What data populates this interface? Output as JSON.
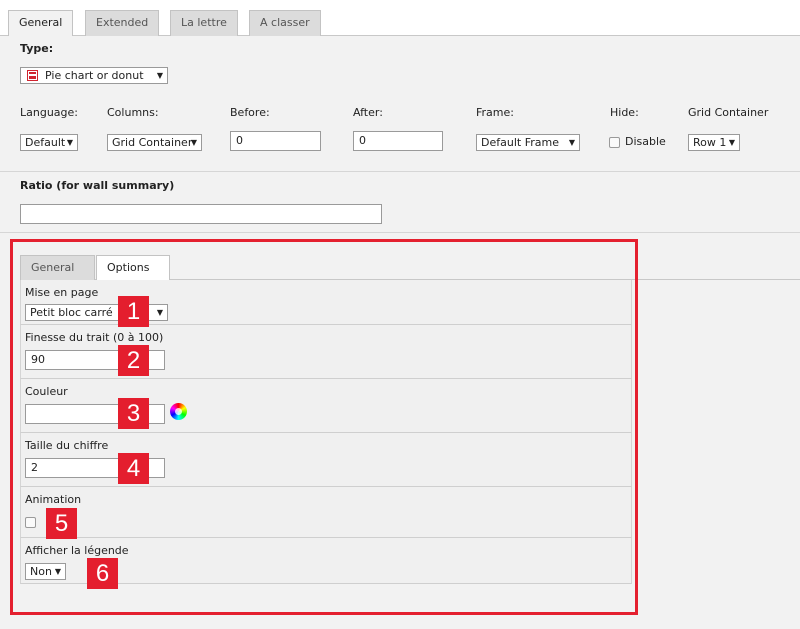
{
  "top_tabs": [
    "General",
    "Extended",
    "La lettre",
    "A classer"
  ],
  "type": {
    "label": "Type:",
    "value": "Pie chart or donut",
    "icon": "pie-chart-icon"
  },
  "fields": {
    "language": {
      "label": "Language:",
      "value": "Default"
    },
    "columns": {
      "label": "Columns:",
      "value": "Grid Container"
    },
    "before": {
      "label": "Before:",
      "value": "0"
    },
    "after": {
      "label": "After:",
      "value": "0"
    },
    "frame": {
      "label": "Frame:",
      "value": "Default Frame"
    },
    "hide": {
      "label": "Hide:",
      "checkbox_label": "Disable"
    },
    "grid_container": {
      "label": "Grid Container",
      "value": "Row 1"
    }
  },
  "ratio": {
    "label": "Ratio (for wall summary)",
    "value": ""
  },
  "sub_tabs": [
    "General",
    "Options"
  ],
  "options": {
    "mise_en_page": {
      "label": "Mise en page",
      "value": "Petit bloc carré",
      "marker": "1"
    },
    "finesse": {
      "label": "Finesse du trait (0 à 100)",
      "value": "90",
      "marker": "2"
    },
    "couleur": {
      "label": "Couleur",
      "value": "",
      "marker": "3"
    },
    "taille": {
      "label": "Taille du chiffre",
      "value": "2",
      "marker": "4"
    },
    "animation": {
      "label": "Animation",
      "marker": "5"
    },
    "legende": {
      "label": "Afficher la légende",
      "value": "Non",
      "marker": "6"
    }
  },
  "colors": {
    "highlight": "#e4202f"
  }
}
